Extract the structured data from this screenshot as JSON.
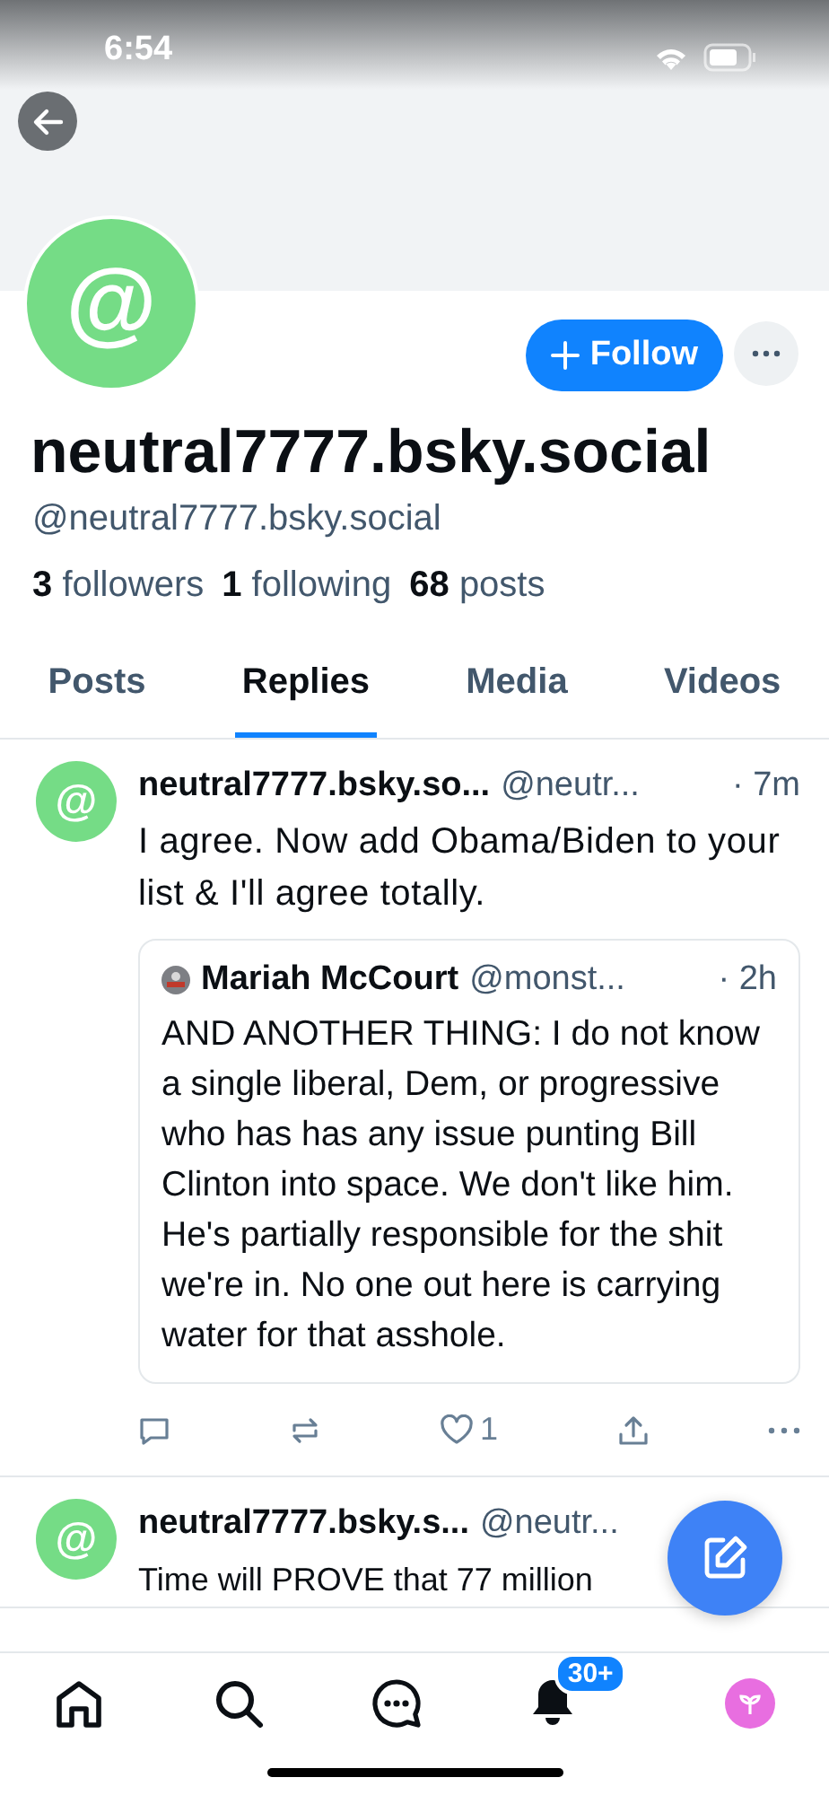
{
  "status_bar": {
    "time": "6:54"
  },
  "profile": {
    "avatar_glyph": "@",
    "follow_button": "Follow",
    "display_name": "neutral7777.bsky.social",
    "handle": "@neutral7777.bsky.social",
    "stats": [
      {
        "count": "3",
        "label": "followers"
      },
      {
        "count": "1",
        "label": "following"
      },
      {
        "count": "68",
        "label": "posts"
      }
    ]
  },
  "tabs": [
    {
      "label": "Posts",
      "selected": false
    },
    {
      "label": "Replies",
      "selected": true
    },
    {
      "label": "Media",
      "selected": false
    },
    {
      "label": "Videos",
      "selected": false
    }
  ],
  "posts": [
    {
      "avatar_glyph": "@",
      "author": "neutral7777.bsky.so...",
      "handle": "@neutr...",
      "time": "· 7m",
      "text": "I agree. Now add Obama/Biden to your list & I'll agree totally.",
      "quote": {
        "author": "Mariah McCourt",
        "handle": "@monst...",
        "time": "· 2h",
        "text": "AND ANOTHER THING: I do not know a single liberal, Dem, or progressive who has has any issue punting Bill Clinton into space. We don't like him. He's partially responsible for the shit we're in. No one out here is carrying water for that asshole."
      },
      "like_count": "1"
    },
    {
      "avatar_glyph": "@",
      "author": "neutral7777.bsky.s...",
      "handle": "@neutr...",
      "text": "Time will PROVE that 77 million"
    }
  ],
  "nav": [
    {
      "kind": "home"
    },
    {
      "kind": "search"
    },
    {
      "kind": "chat"
    },
    {
      "kind": "bell",
      "badge": "30+"
    },
    {
      "kind": "avatar"
    }
  ]
}
